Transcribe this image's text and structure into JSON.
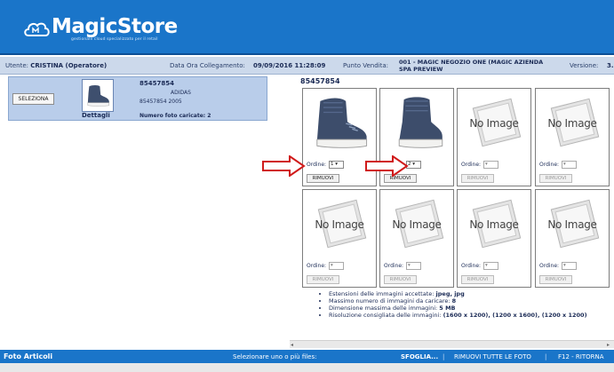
{
  "app": {
    "name": "MagicStore",
    "tagline": "gestionale cloud specializzato per il retail"
  },
  "infobar": {
    "user_label": "Utente:",
    "user_value": "CRISTINA (Operatore)",
    "date_label": "Data Ora Collegamento:",
    "date_value": "09/09/2016 11:28:09",
    "store_label": "Punto Vendita:",
    "store_value_line1": "001 - MAGIC NEGOZIO ONE (MAGIC AZIENDA",
    "store_value_line2": "SPA PREVIEW",
    "version_label": "Versione:",
    "version_value": "3."
  },
  "left_panel": {
    "select_button": "SELEZIONA",
    "details_label": "Dettagli",
    "article_code": "85457854",
    "brand": "ADIDAS",
    "description": "85457854 2005",
    "photos_label": "Numero foto caricate: 2"
  },
  "main": {
    "article_code": "85457854",
    "order_label": "Ordine:",
    "remove_label": "RIMUOVI",
    "no_image_text": "No Image",
    "slots": [
      {
        "order": "1",
        "has_image": true
      },
      {
        "order": "2",
        "has_image": true
      },
      {
        "order": "",
        "has_image": false
      },
      {
        "order": "",
        "has_image": false
      },
      {
        "order": "",
        "has_image": false
      },
      {
        "order": "",
        "has_image": false
      },
      {
        "order": "",
        "has_image": false
      },
      {
        "order": "",
        "has_image": false
      }
    ],
    "notes": {
      "ext_label": "Estensioni delle immagini accettate:",
      "ext_value": "jpeg, jpg",
      "max_label": "Massimo numero di immagini da caricare:",
      "max_value": "8",
      "size_label": "Dimensione massima delle immagini:",
      "size_value": "5 MB",
      "res_label": "Risoluzione consigliata delle immagini:",
      "res_value": "(1600 x 1200), (1200 x 1600), (1200 x 1200)"
    }
  },
  "footer": {
    "title": "Foto Articoli",
    "hint": "Selezionare uno o più files:",
    "browse": "SFOGLIA...",
    "remove_all": "RIMUOVI TUTTE LE FOTO",
    "back": "F12 - RITORNA",
    "separator": "|"
  },
  "colors": {
    "header_blue": "#1a75c9",
    "panel_blue": "#b9cdea",
    "arrow_red": "#d01a1a"
  }
}
